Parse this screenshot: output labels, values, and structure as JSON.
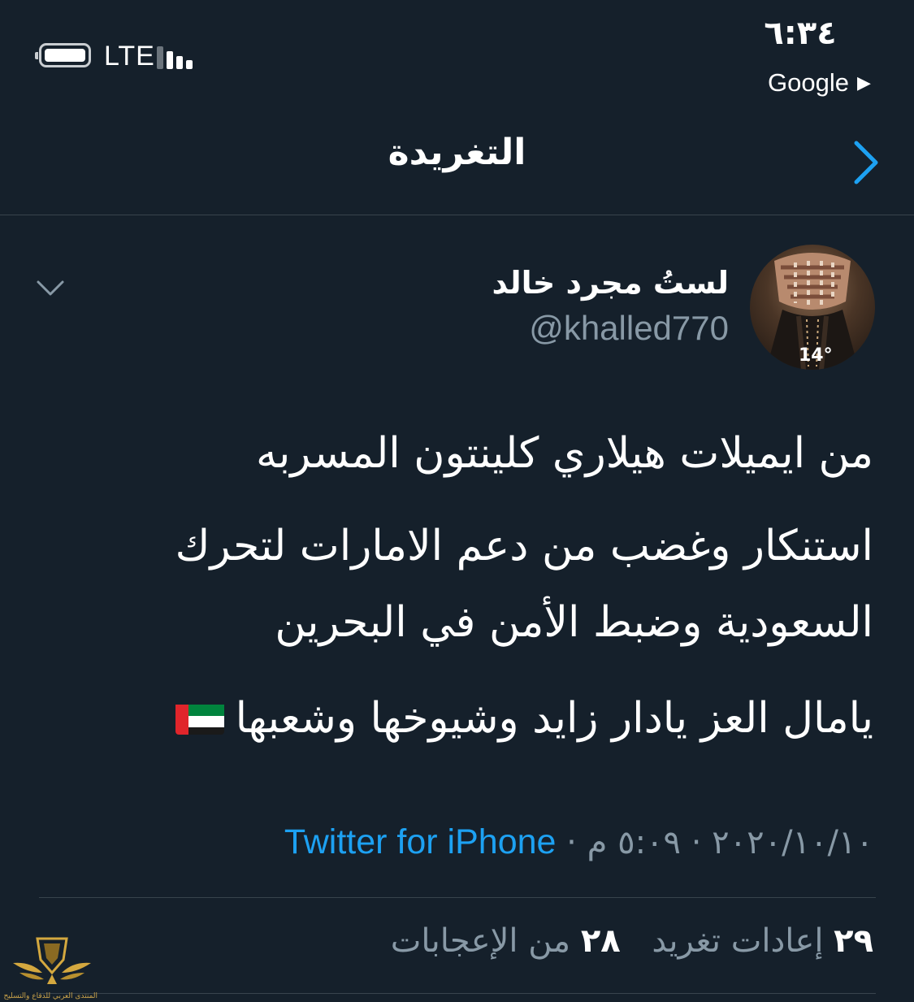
{
  "status_bar": {
    "network": "LTE",
    "time": "٦:٣٤",
    "back_app": "Google",
    "back_arrow": "▶"
  },
  "header": {
    "title": "التغريدة",
    "back_icon": "chevron-right-icon"
  },
  "tweet": {
    "author_name": "لستُ مجرد خالد",
    "handle": "@khalled770",
    "avatar_temp": "14°",
    "more_icon": "chevron-down-icon",
    "lines": [
      "من ايميلات هيلاري كلينتون المسربه",
      "استنكار وغضب من دعم الامارات لتحرك",
      "السعودية وضبط الأمن في البحرين",
      "يامال العز يادار زايد وشيوخها وشعبها"
    ],
    "flag": "uae-flag",
    "date": "٢٠٢٠/١٠/١٠",
    "time": "٥:٠٩ م",
    "separator": "·",
    "source": "Twitter for iPhone"
  },
  "stats": {
    "retweets_count": "٢٩",
    "retweets_label": "إعادات تغريد",
    "likes_count": "٢٨",
    "likes_label": "من الإعجابات"
  },
  "watermark": {
    "text": "المنتدى العربي للدفاع والتسليح"
  },
  "colors": {
    "background": "#15202b",
    "divider": "#38444d",
    "secondary_text": "#8899a6",
    "link": "#1da1f2",
    "back_icon": "#1da1f2"
  }
}
